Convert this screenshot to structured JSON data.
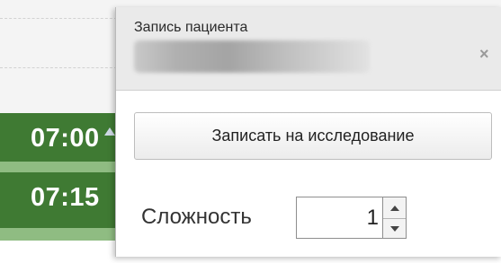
{
  "schedule": {
    "slots": [
      "07:00",
      "07:15"
    ]
  },
  "popup": {
    "title": "Запись пациента",
    "close_symbol": "×",
    "study_button_label": "Записать на исследование",
    "complexity_label": "Сложность",
    "complexity_value": "1"
  },
  "colors": {
    "slot_green": "#3f7a33",
    "slot_strip": "#8fbc82",
    "header_bg": "#eaeaea"
  }
}
